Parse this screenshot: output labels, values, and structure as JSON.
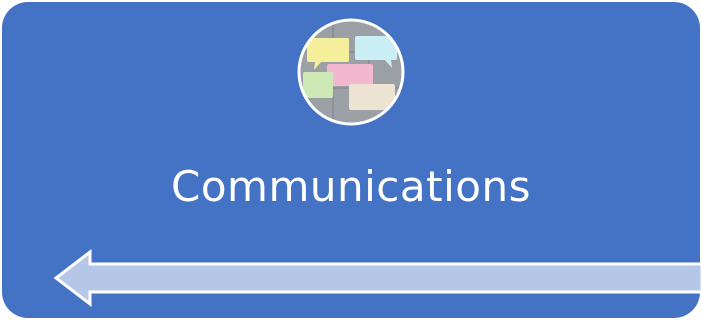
{
  "card": {
    "title": "Communications",
    "background_color": "#4472c4",
    "text_color": "#ffffff"
  },
  "avatar": {
    "icon": "speech-bubbles-icon",
    "bubble_colors": [
      "#f5ef9b",
      "#c9eef6",
      "#f3b7cf",
      "#cde8b5",
      "#ece3d3"
    ]
  },
  "arrow": {
    "icon": "left-arrow-icon",
    "fill_color": "#b4c7e7"
  }
}
